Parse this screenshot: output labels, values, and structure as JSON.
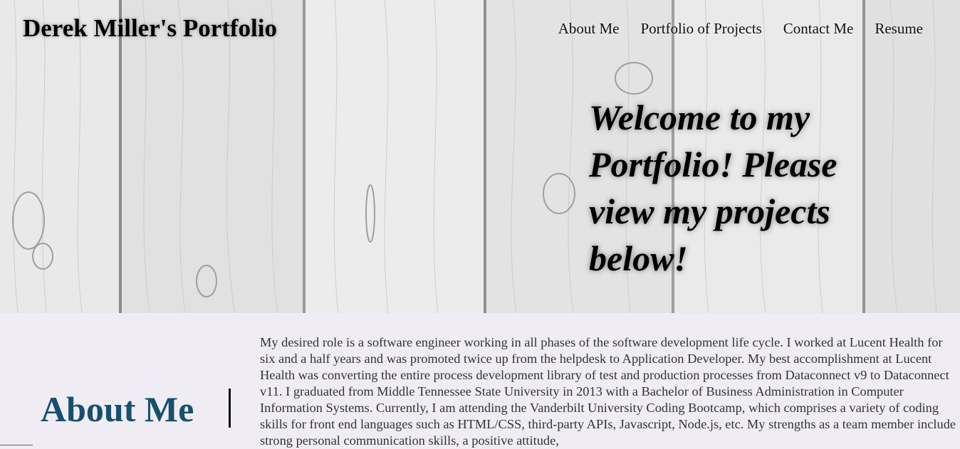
{
  "header": {
    "title": "Derek Miller's Portfolio",
    "nav": [
      {
        "label": "About Me"
      },
      {
        "label": "Portfolio of Projects"
      },
      {
        "label": "Contact Me"
      },
      {
        "label": "Resume"
      }
    ]
  },
  "hero": {
    "welcome": "Welcome to my Portfolio! Please view my projects below!"
  },
  "about": {
    "heading": "About Me",
    "text": "My desired role is a software engineer working in all phases of the software development life cycle. I worked at Lucent Health for six and a half years and was promoted twice up from the helpdesk to Application Developer. My best accomplishment at Lucent Health was converting the entire process development library of test and production processes from Dataconnect v9 to Dataconnect v11. I graduated from Middle Tennessee State University in 2013 with a Bachelor of Business Administration in Computer Information Systems. Currently, I am attending the Vanderbilt University Coding Bootcamp, which comprises a variety of coding skills for front end languages such as HTML/CSS, third-party APIs, Javascript, Node.js, etc. My strengths as a team member include strong personal communication skills, a positive attitude,"
  },
  "colors": {
    "about_heading": "#17506e",
    "section_background": "#efedf3"
  }
}
